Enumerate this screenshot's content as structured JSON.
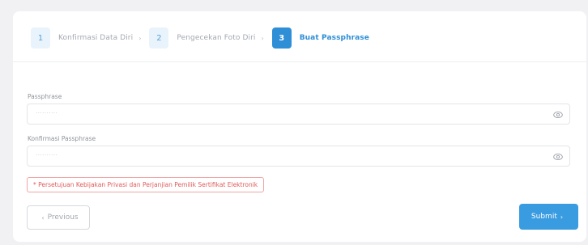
{
  "stepper": {
    "steps": [
      {
        "number": "1",
        "label": "Konfirmasi Data Diri",
        "chevron": "›"
      },
      {
        "number": "2",
        "label": "Pengecekan Foto Diri",
        "chevron": "›"
      },
      {
        "number": "3",
        "label": "Buat Passphrase"
      }
    ],
    "active_step": 3
  },
  "form": {
    "passphrase": {
      "label": "Passphrase",
      "placeholder": "··········",
      "icon": "eye-icon"
    },
    "confirm_passphrase": {
      "label": "Konfirmasi Passphrase",
      "placeholder": "··········",
      "icon": "eye-icon"
    },
    "agreement_error": "* Persetujuan Kebijakan Privasi dan Perjanjian Pemilik Sertifikat Elektronik"
  },
  "actions": {
    "previous_label": "Previous",
    "previous_chevron": "‹",
    "submit_label": "Submit",
    "submit_chevron": "›"
  },
  "colors": {
    "primary": "#2e8ed6",
    "error": "#e05a5a",
    "background": "#f1f1f3"
  }
}
